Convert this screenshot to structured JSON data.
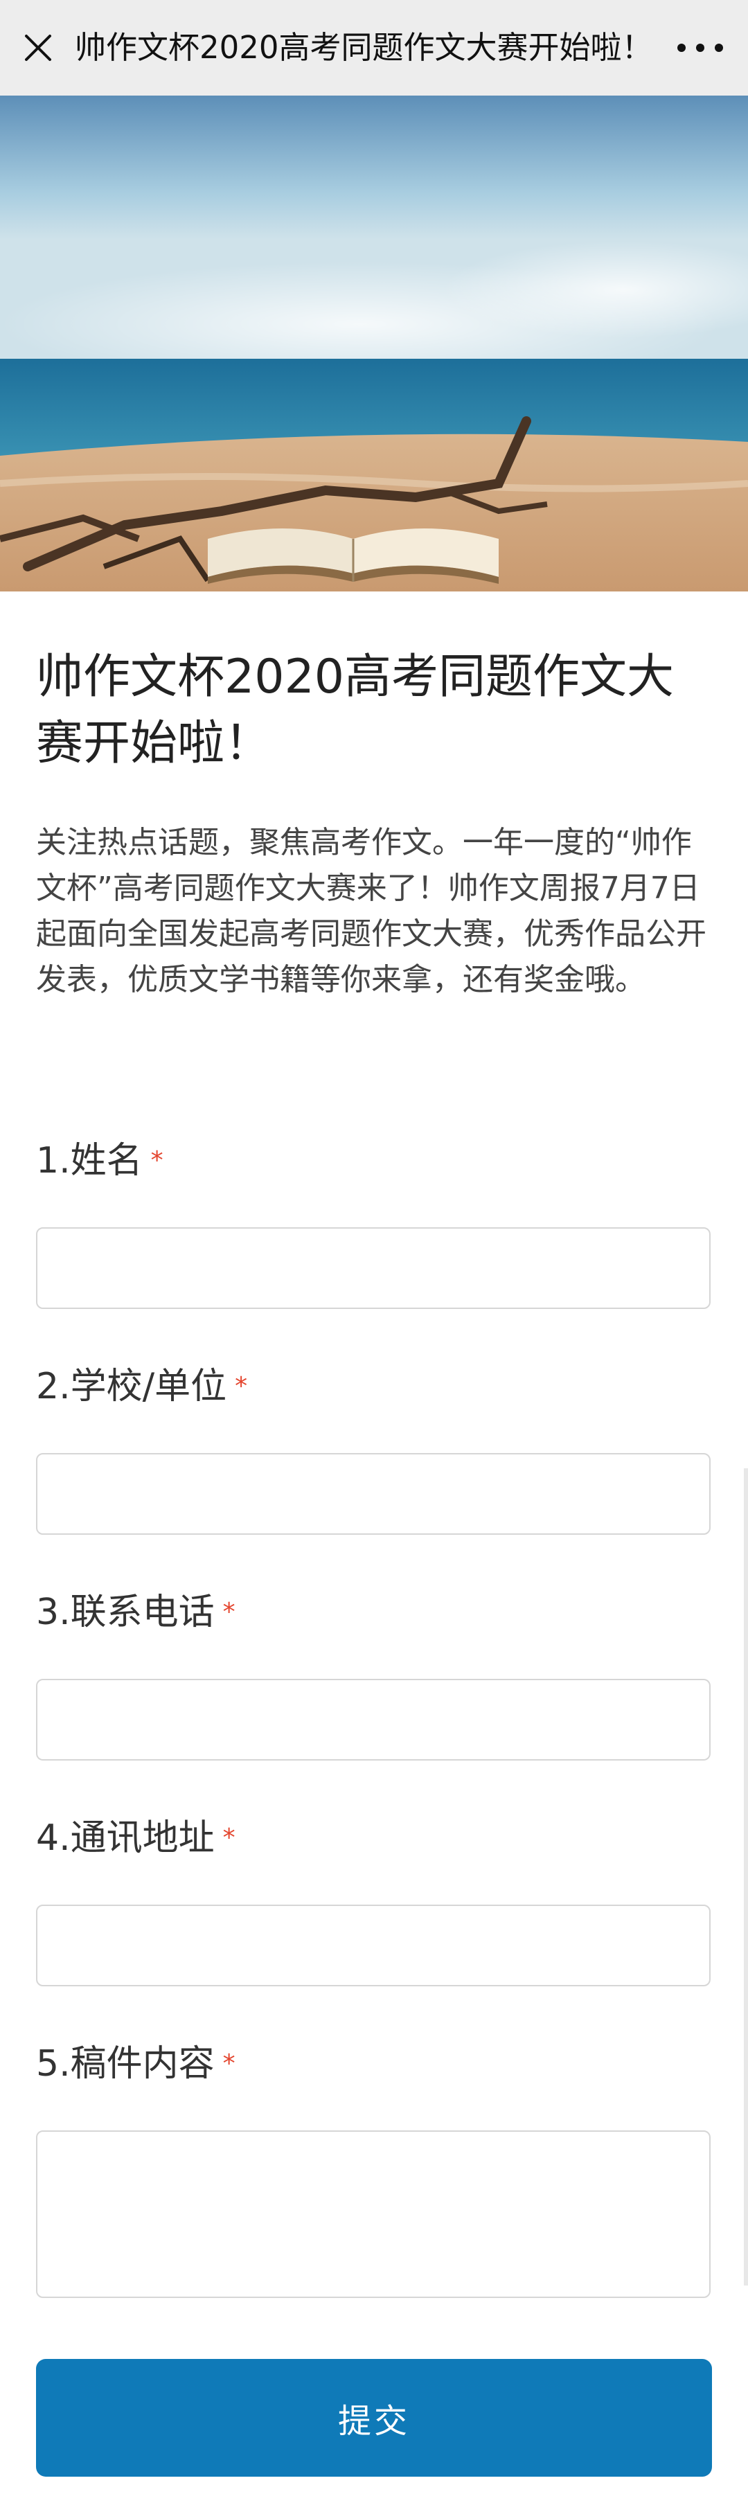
{
  "topbar": {
    "title": "帅作文杯2020高考同题作文大赛开始啦！",
    "close_icon": "close-icon",
    "more_icon": "more-icon"
  },
  "hero": {
    "image": "beach-with-open-book"
  },
  "form": {
    "title": "帅作文杯2020高考同题作文大赛开始啦！",
    "description": "关注热点话题，聚焦高考作文。一年一度的“帅作文杯”高考同题作文大赛来了！帅作文周报7月7日起面向全国发起高考同题作文大赛，优秀作品公开发表，优质文学书籍等你来拿，还有奖金哦。",
    "questions": [
      {
        "label": "1.姓名",
        "required": "*"
      },
      {
        "label": "2.学校/单位",
        "required": "*"
      },
      {
        "label": "3.联系电话",
        "required": "*"
      },
      {
        "label": "4.通讯地址",
        "required": "*"
      },
      {
        "label": "5.稿件内容",
        "required": "*"
      }
    ],
    "submit_label": "提交"
  },
  "colors": {
    "accent": "#0f7ab8",
    "required": "#e4462f",
    "topbar": "#ededed"
  }
}
